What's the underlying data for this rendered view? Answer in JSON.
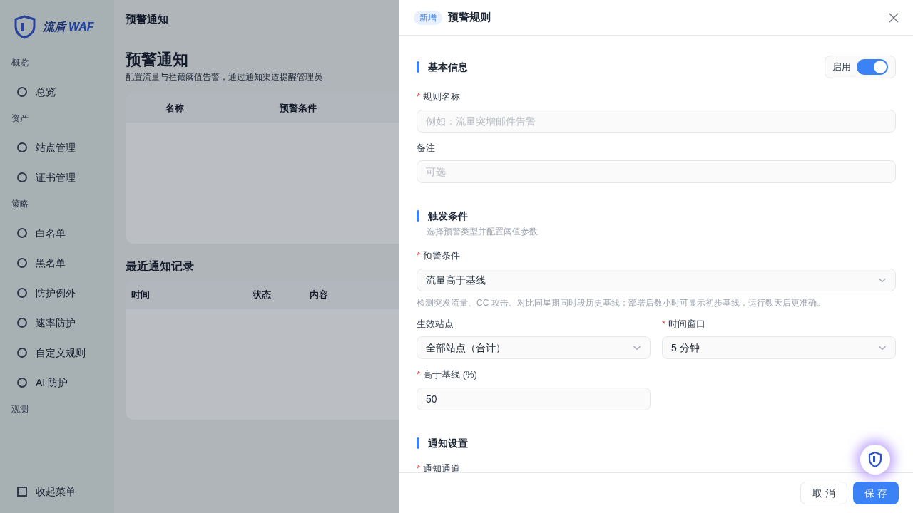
{
  "background": {
    "logo": {
      "name": "流盾",
      "suffix": "WAF"
    },
    "breadcrumb": "预警通知",
    "page_title": "预警通知",
    "page_subtitle": "配置流量与拦截阈值告警，通过通知渠道提醒管理员",
    "sidebar": [
      {
        "group": "概览",
        "items": [
          "总览"
        ]
      },
      {
        "group": "资产",
        "items": [
          "站点管理",
          "证书管理"
        ]
      },
      {
        "group": "策略",
        "items": [
          "白名单",
          "黑名单",
          "防护例外",
          "速率防护",
          "自定义规则",
          "AI 防护"
        ]
      },
      {
        "group": "观测"
      }
    ],
    "collapse": "收起菜单",
    "rules_table": {
      "columns": [
        "名称",
        "预警条件"
      ]
    },
    "records_title": "最近通知记录",
    "records_table": {
      "columns": [
        "时间",
        "状态",
        "内容"
      ]
    }
  },
  "drawer": {
    "badge": "新增",
    "title": "预警规则",
    "required_mark": "*",
    "sections": [
      {
        "title": "基本信息",
        "enabled_label": "启用",
        "enabled": true,
        "rows": [
          [
            {
              "kind": "input",
              "label": "规则名称",
              "required": true,
              "placeholder": "例如：流量突增邮件告警"
            }
          ],
          [
            {
              "kind": "input",
              "label": "备注",
              "required": false,
              "placeholder": "可选"
            }
          ]
        ]
      },
      {
        "title": "触发条件",
        "subtitle": "选择预警类型并配置阈值参数",
        "rows": [
          [
            {
              "kind": "select",
              "label": "预警条件",
              "required": true,
              "value": "流量高于基线",
              "help": "检测突发流量、CC 攻击。对比同星期同时段历史基线；部署后数小时可显示初步基线，运行数天后更准确。"
            }
          ],
          [
            {
              "kind": "select",
              "label": "生效站点",
              "required": false,
              "value": "全部站点（合计）"
            },
            {
              "kind": "select",
              "label": "时间窗口",
              "required": true,
              "value": "5 分钟"
            }
          ],
          [
            {
              "kind": "input",
              "label": "高于基线 (%)",
              "required": true,
              "value": "50"
            }
          ]
        ]
      },
      {
        "title": "通知设置",
        "rows": [
          [
            {
              "kind": "label",
              "label": "通知通道",
              "required": true
            }
          ]
        ]
      }
    ],
    "buttons": [
      {
        "label": "取 消",
        "kind": "secondary"
      },
      {
        "label": "保 存",
        "kind": "primary"
      }
    ]
  }
}
